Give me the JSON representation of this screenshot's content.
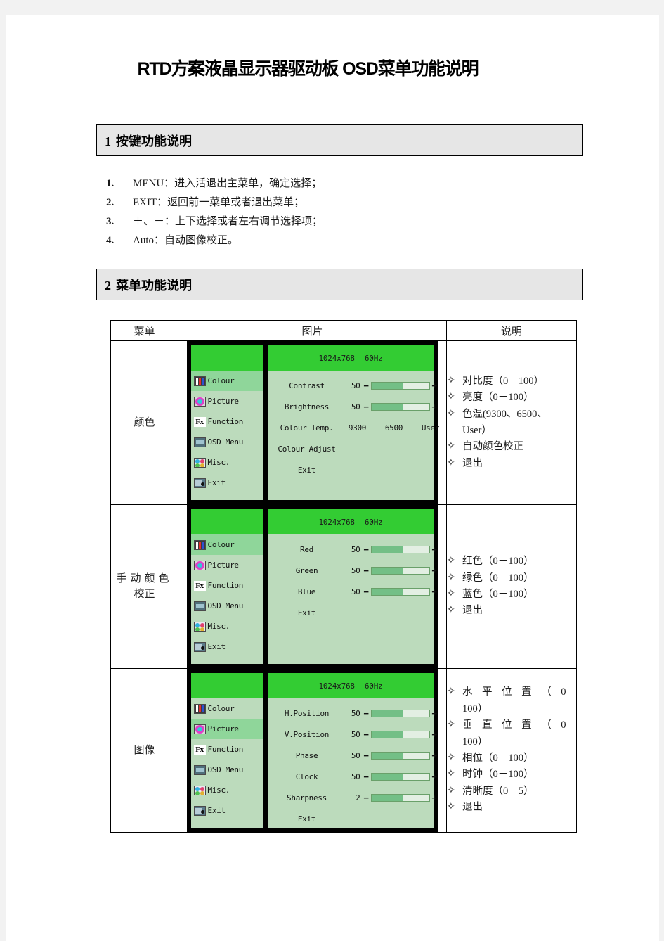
{
  "document": {
    "title": "RTD方案液晶显示器驱动板 OSD菜单功能说明"
  },
  "sections": [
    {
      "number": "1",
      "heading": "按键功能说明"
    },
    {
      "number": "2",
      "heading": "菜单功能说明"
    }
  ],
  "key_functions": [
    {
      "num": "1.",
      "text": "MENU：进入活退出主菜单，确定选择；"
    },
    {
      "num": "2.",
      "text": "EXIT：返回前一菜单或者退出菜单；"
    },
    {
      "num": "3.",
      "text": "＋、－：上下选择或者左右调节选择项；"
    },
    {
      "num": "4.",
      "text": "Auto：自动图像校正。"
    }
  ],
  "table": {
    "headers": {
      "menu": "菜单",
      "picture": "图片",
      "description": "说明"
    },
    "rows": [
      {
        "menu_label": "颜色",
        "osd": {
          "header": {
            "resolution": "1024x768",
            "refresh": "60Hz"
          },
          "sidebar": [
            {
              "label": "Colour",
              "icon": "colour-icon",
              "active": true
            },
            {
              "label": "Picture",
              "icon": "picture-icon",
              "active": false
            },
            {
              "label": "Function",
              "icon": "function-icon",
              "active": false
            },
            {
              "label": "OSD Menu",
              "icon": "osd-menu-icon",
              "active": false
            },
            {
              "label": "Misc.",
              "icon": "misc-icon",
              "active": false
            },
            {
              "label": "Exit",
              "icon": "exit-icon",
              "active": false
            }
          ],
          "items": [
            {
              "type": "slider",
              "label": "Contrast",
              "value": "50",
              "minus": "−",
              "plus": "+",
              "fill_pct": 55
            },
            {
              "type": "slider",
              "label": "Brightness",
              "value": "50",
              "minus": "−",
              "plus": "+",
              "fill_pct": 55
            },
            {
              "type": "options",
              "label": "Colour Temp.",
              "options": [
                "9300",
                "6500",
                "User"
              ]
            },
            {
              "type": "text",
              "label": "Colour Adjust"
            },
            {
              "type": "text",
              "label": "Exit"
            }
          ]
        },
        "description": [
          {
            "text": "对比度（0－100）"
          },
          {
            "text": "亮度（0－100）"
          },
          {
            "text": "色温(9300、6500、User）",
            "lines": [
              "色温(9300、6500、",
              "User）"
            ]
          },
          {
            "text": "自动颜色校正"
          },
          {
            "text": "退出"
          }
        ]
      },
      {
        "menu_label": "手动颜色校正",
        "menu_lines": [
          "手动颜色",
          "校正"
        ],
        "osd": {
          "header": {
            "resolution": "1024x768",
            "refresh": "60Hz"
          },
          "sidebar": [
            {
              "label": "Colour",
              "icon": "colour-icon",
              "active": true
            },
            {
              "label": "Picture",
              "icon": "picture-icon",
              "active": false
            },
            {
              "label": "Function",
              "icon": "function-icon",
              "active": false
            },
            {
              "label": "OSD Menu",
              "icon": "osd-menu-icon",
              "active": false
            },
            {
              "label": "Misc.",
              "icon": "misc-icon",
              "active": false
            },
            {
              "label": "Exit",
              "icon": "exit-icon",
              "active": false
            }
          ],
          "items": [
            {
              "type": "slider",
              "label": "Red",
              "value": "50",
              "minus": "−",
              "plus": "+",
              "fill_pct": 55
            },
            {
              "type": "slider",
              "label": "Green",
              "value": "50",
              "minus": "−",
              "plus": "+",
              "fill_pct": 55
            },
            {
              "type": "slider",
              "label": "Blue",
              "value": "50",
              "minus": "−",
              "plus": "+",
              "fill_pct": 55
            },
            {
              "type": "text",
              "label": "Exit"
            }
          ]
        },
        "description": [
          {
            "text": "红色（0－100）"
          },
          {
            "text": "绿色（0－100）"
          },
          {
            "text": "蓝色（0－100）"
          },
          {
            "text": "退出"
          }
        ]
      },
      {
        "menu_label": "图像",
        "osd": {
          "header": {
            "resolution": "1024x768",
            "refresh": "60Hz"
          },
          "sidebar": [
            {
              "label": "Colour",
              "icon": "colour-icon",
              "active": false
            },
            {
              "label": "Picture",
              "icon": "picture-icon",
              "active": true
            },
            {
              "label": "Function",
              "icon": "function-icon",
              "active": false
            },
            {
              "label": "OSD Menu",
              "icon": "osd-menu-icon",
              "active": false
            },
            {
              "label": "Misc.",
              "icon": "misc-icon",
              "active": false
            },
            {
              "label": "Exit",
              "icon": "exit-icon",
              "active": false
            }
          ],
          "items": [
            {
              "type": "slider",
              "label": "H.Position",
              "value": "50",
              "minus": "−",
              "plus": "+",
              "fill_pct": 55
            },
            {
              "type": "slider",
              "label": "V.Position",
              "value": "50",
              "minus": "−",
              "plus": "+",
              "fill_pct": 55
            },
            {
              "type": "slider",
              "label": "Phase",
              "value": "50",
              "minus": "−",
              "plus": "+",
              "fill_pct": 55
            },
            {
              "type": "slider",
              "label": "Clock",
              "value": "50",
              "minus": "−",
              "plus": "+",
              "fill_pct": 55
            },
            {
              "type": "slider",
              "label": "Sharpness",
              "value": "2",
              "minus": "−",
              "plus": "+",
              "fill_pct": 55
            },
            {
              "type": "text",
              "label": "Exit"
            }
          ]
        },
        "description": [
          {
            "text": "水平位置（0－100）",
            "lines": [
              "水平位置（0－",
              "100）"
            ],
            "justify_first": true
          },
          {
            "text": "垂直位置（0－100）",
            "lines": [
              "垂直位置（0－",
              "100）"
            ],
            "justify_first": true
          },
          {
            "text": "相位（0－100）"
          },
          {
            "text": "时钟（0－100）"
          },
          {
            "text": "清晰度（0－5）"
          },
          {
            "text": "退出"
          }
        ]
      }
    ]
  },
  "glyphs": {
    "bullet": "✧",
    "function_icon_text": "Fx"
  },
  "colors": {
    "osd_header_green": "#33cc33",
    "osd_body_green": "#bcdbbc",
    "osd_active_green": "#8fd69a",
    "osd_bar_fill": "#73bf86",
    "section_bar_bg": "#e6e6e6",
    "page_bg": "#f2f2f2"
  }
}
